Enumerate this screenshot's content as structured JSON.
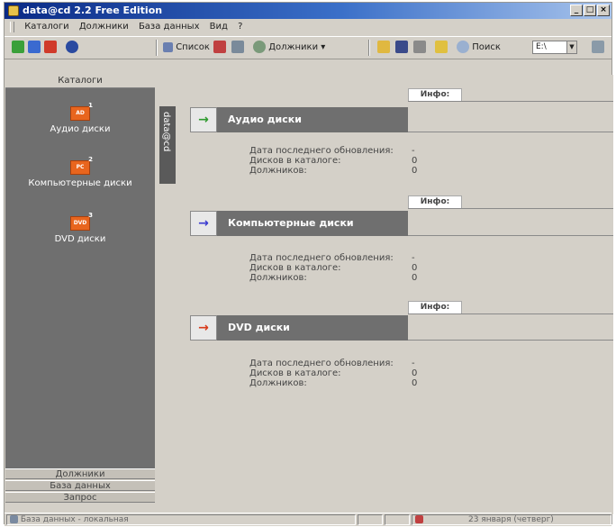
{
  "window": {
    "title": "data@cd 2.2 Free Edition"
  },
  "menu": [
    "Каталоги",
    "Должники",
    "База данных",
    "Вид",
    "?"
  ],
  "toolbar": {
    "list": "Список",
    "debtors": "Должники",
    "search": "Поиск",
    "drive": "E:\\"
  },
  "sidebar": {
    "header": "Каталоги",
    "items": [
      {
        "label": "Аудио диски",
        "badge": "1",
        "icon_text": "AD"
      },
      {
        "label": "Компьютерные диски",
        "badge": "2",
        "icon_text": "PC"
      },
      {
        "label": "DVD диски",
        "badge": "3",
        "icon_text": "DVD"
      }
    ],
    "vertical_tab": "data@cd",
    "bottom_tabs": [
      "Должники",
      "База данных",
      "Запрос"
    ]
  },
  "info_tab": "Инфо:",
  "catalogs": [
    {
      "name": "Аудио диски",
      "arrow_color": "#2e9a2e",
      "fields": [
        {
          "k": "Дата последнего обновления:",
          "v": "-"
        },
        {
          "k": "Дисков в каталоге:",
          "v": "0"
        },
        {
          "k": "Должников:",
          "v": "0"
        }
      ]
    },
    {
      "name": "Компьютерные диски",
      "arrow_color": "#3a3ad0",
      "fields": [
        {
          "k": "Дата последнего обновления:",
          "v": "-"
        },
        {
          "k": "Дисков в каталоге:",
          "v": "0"
        },
        {
          "k": "Должников:",
          "v": "0"
        }
      ]
    },
    {
      "name": "DVD диски",
      "arrow_color": "#d83a1a",
      "fields": [
        {
          "k": "Дата последнего обновления:",
          "v": "-"
        },
        {
          "k": "Дисков в каталоге:",
          "v": "0"
        },
        {
          "k": "Должников:",
          "v": "0"
        }
      ]
    }
  ],
  "statusbar": {
    "db": "База данных - локальная",
    "date": "23 января (четверг)"
  }
}
